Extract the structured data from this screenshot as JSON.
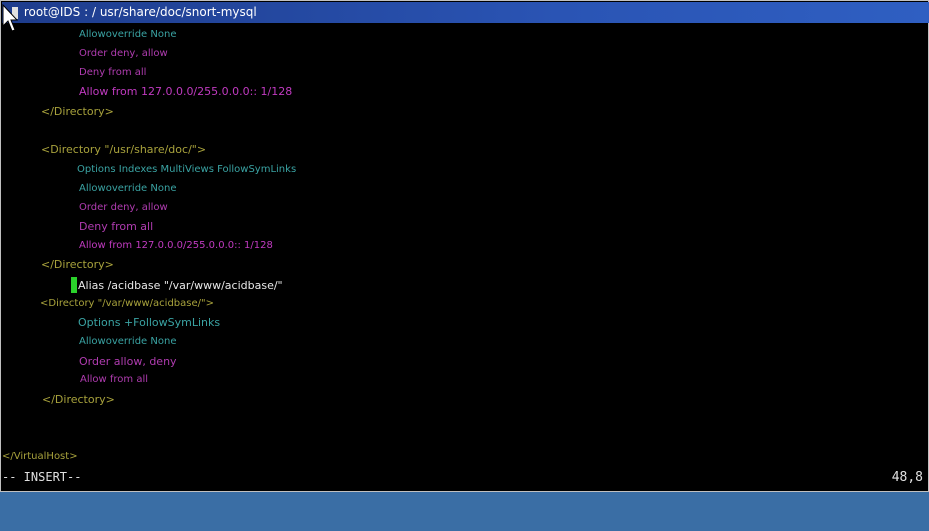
{
  "window": {
    "title": "root@IDS : / usr/share/doc/snort-mysql"
  },
  "editor": {
    "lines": [
      "Allowoverride None",
      "Order deny, allow",
      "Deny from all",
      "Allow from 127.0.0.0/255.0.0.0:: 1/128",
      "</Directory>",
      "<Directory \"/usr/share/doc/\">",
      "Options Indexes MultiViews FollowSymLinks",
      "Allowoverride None",
      "Order deny, allow",
      "Deny from all",
      "Allow from 127.0.0.0/255.0.0.0:: 1/128",
      "</Directory>",
      "Alias /acidbase \"/var/www/acidbase/\"",
      "<Directory \"/var/www/acidbase/\">",
      "Options +FollowSymLinks",
      "Allowoverride None",
      "Order allow, deny",
      "Allow from all",
      "</Directory>",
      "</VirtualHost>"
    ]
  },
  "status": {
    "mode": "-- INSERT--",
    "position": "48,8"
  },
  "colors": {
    "desktop": "#3a6ea5",
    "titlebar": "#2a54b4",
    "cursor": "#2bd22b"
  }
}
